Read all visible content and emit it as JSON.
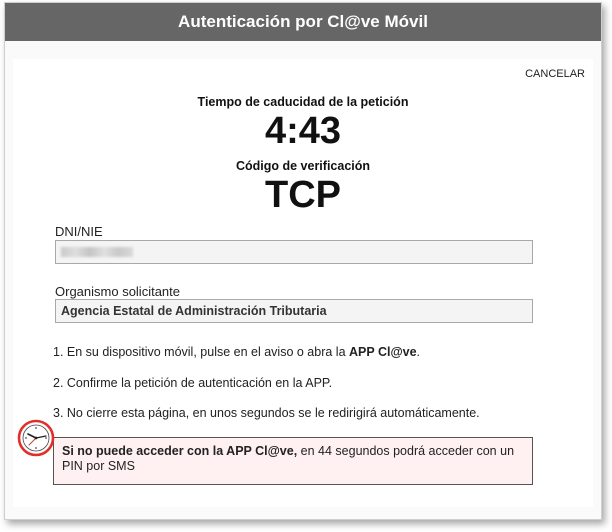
{
  "title": "Autenticación por Cl@ve Móvil",
  "cancel_label": "CANCELAR",
  "timer": {
    "label": "Tiempo de caducidad de la petición",
    "value": "4:43"
  },
  "verification": {
    "label": "Código de verificación",
    "code": "TCP"
  },
  "fields": {
    "dni_label": "DNI/NIE",
    "org_label": "Organismo solicitante",
    "org_value": "Agencia Estatal de Administración Tributaria"
  },
  "steps": [
    {
      "prefix": "1. En su dispositivo móvil, pulse en el aviso o abra la ",
      "bold": "APP Cl@ve",
      "suffix": "."
    },
    {
      "prefix": "2. Confirme la petición de autenticación en la APP.",
      "bold": "",
      "suffix": ""
    },
    {
      "prefix": "3. No cierre esta página, en unos segundos se le redirigirá automáticamente.",
      "bold": "",
      "suffix": ""
    }
  ],
  "notice": {
    "bold": "Si no puede acceder con la APP Cl@ve,",
    "text": " en 44 segundos podrá acceder con un PIN por SMS"
  },
  "colors": {
    "titlebar": "#666666",
    "notice_bg": "#fff1f1",
    "clock_ring": "#e0302a"
  }
}
